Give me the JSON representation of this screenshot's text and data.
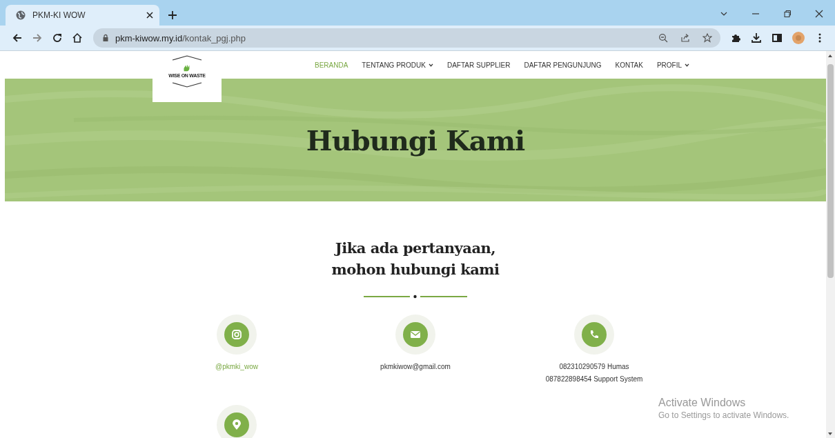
{
  "browser": {
    "tab_title": "PKM-KI WOW",
    "url_host": "pkm-kiwow.my.id",
    "url_path": "/kontak_pgj.php"
  },
  "logo": {
    "text": "WISE ON WASTE"
  },
  "nav": [
    {
      "label": "BERANDA",
      "selected": true,
      "dropdown": false
    },
    {
      "label": "TENTANG PRODUK",
      "selected": false,
      "dropdown": true
    },
    {
      "label": "DAFTAR SUPPLIER",
      "selected": false,
      "dropdown": false
    },
    {
      "label": "DAFTAR PENGUNJUNG",
      "selected": false,
      "dropdown": false
    },
    {
      "label": "KONTAK",
      "selected": false,
      "dropdown": false
    },
    {
      "label": "PROFIL",
      "selected": false,
      "dropdown": true
    }
  ],
  "hero": {
    "title": "Hubungi Kami"
  },
  "heading": [
    "Jika ada pertanyaan,",
    "mohon hubungi kami"
  ],
  "contacts": [
    {
      "kind": "instagram",
      "link": true,
      "lines": [
        "@pkmki_wow"
      ]
    },
    {
      "kind": "email",
      "link": false,
      "lines": [
        "pkmkiwow@gmail.com"
      ]
    },
    {
      "kind": "phone",
      "link": false,
      "lines": [
        "082310290579 Humas",
        "087822898454 Support System"
      ]
    },
    {
      "kind": "location"
    }
  ],
  "os_notice": {
    "title": "Activate Windows",
    "subtitle": "Go to Settings to activate Windows."
  }
}
